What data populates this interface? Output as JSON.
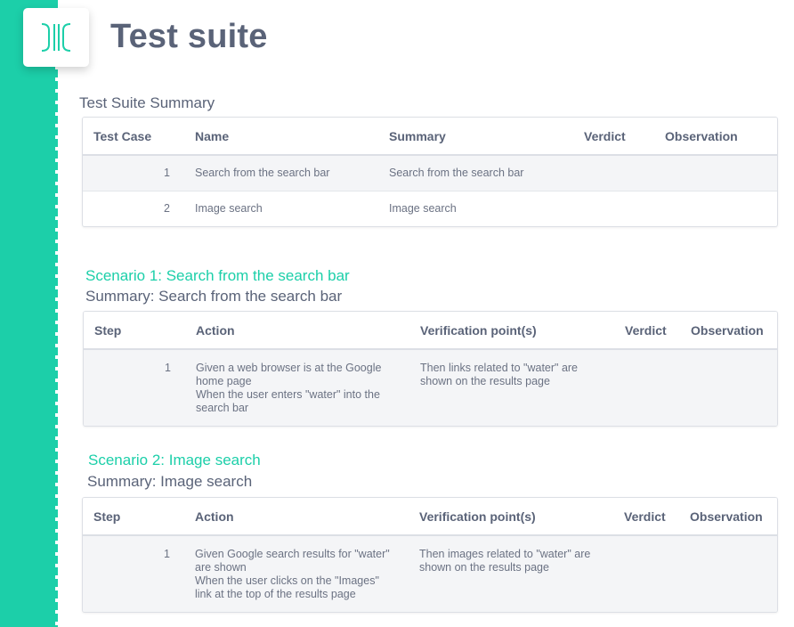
{
  "header": {
    "title": "Test suite"
  },
  "colors": {
    "accent": "#1ccfa9",
    "text": "#5a6378",
    "row_shade": "#f4f5f7"
  },
  "summary": {
    "heading": "Test Suite Summary",
    "columns": [
      "Test Case",
      "Name",
      "Summary",
      "Verdict",
      "Observation"
    ],
    "rows": [
      {
        "test_case": "1",
        "name": "Search from the search bar",
        "summary": "Search from the search bar",
        "verdict": "",
        "observation": ""
      },
      {
        "test_case": "2",
        "name": "Image search",
        "summary": "Image search",
        "verdict": "",
        "observation": ""
      }
    ]
  },
  "scenarios": [
    {
      "title": "Scenario 1: Search from the search bar",
      "summary": "Summary: Search from the search bar",
      "columns": [
        "Step",
        "Action",
        "Verification point(s)",
        "Verdict",
        "Observation"
      ],
      "steps": [
        {
          "step": "1",
          "action": "Given a web browser is at the Google\nhome page\nWhen the user enters \"water\" into the\nsearch bar",
          "verification": "Then links related to \"water\" are\nshown on the results page",
          "verdict": "",
          "observation": ""
        }
      ]
    },
    {
      "title": "Scenario 2: Image search",
      "summary": "Summary: Image search",
      "columns": [
        "Step",
        "Action",
        "Verification point(s)",
        "Verdict",
        "Observation"
      ],
      "steps": [
        {
          "step": "1",
          "action": "Given Google search results for \"water\"\nare shown\nWhen the user clicks on the \"Images\"\nlink at the top of the results page",
          "verification": "Then images related to \"water\" are\nshown on the results page",
          "verdict": "",
          "observation": ""
        }
      ]
    }
  ]
}
